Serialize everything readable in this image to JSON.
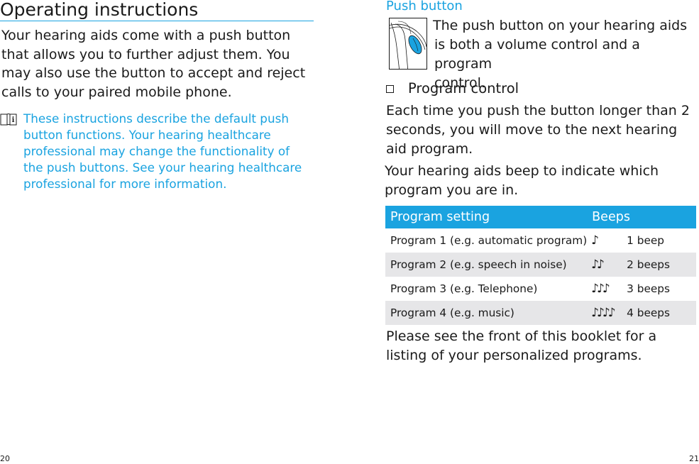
{
  "left_page": {
    "title": "Operating instructions",
    "intro": "Your hearing aids come with a push button that allows you to further adjust them. You may also use the button to accept and reject calls to your paired mobile phone.",
    "note": {
      "icon": "info-book-icon",
      "text": "These instructions describe the default push button functions. Your hearing healthcare professional may change the functionality of the push buttons. See your hearing healthcare professional for more information."
    },
    "page_number": "20"
  },
  "right_page": {
    "section_heading": "Push button",
    "illustration": "hearing-aid-push-button-illustration",
    "device_text": {
      "line1": "The push button on your hearing aids",
      "line2": "is both a volume control and a program",
      "line3": "control."
    },
    "checkbox_label": "Program control",
    "paragraph1": "Each time you push the button longer than 2 seconds, you will move to the next hearing aid program.",
    "paragraph2": "Your hearing aids beep to indicate which program you are in.",
    "table": {
      "headers": {
        "setting": "Program setting",
        "beeps": "Beeps"
      },
      "rows": [
        {
          "setting": "Program 1 (e.g. automatic program)",
          "notes": "♪",
          "beeps": "1 beep"
        },
        {
          "setting": "Program 2 (e.g. speech in noise)",
          "notes": "♪♪",
          "beeps": "2 beeps"
        },
        {
          "setting": "Program 3 (e.g. Telephone)",
          "notes": "♪♪♪",
          "beeps": "3 beeps"
        },
        {
          "setting": "Program 4 (e.g. music)",
          "notes": "♪♪♪♪",
          "beeps": "4 beeps"
        }
      ]
    },
    "closing": "Please see the front of this booklet for a listing of your personalized programs.",
    "page_number": "21"
  },
  "colors": {
    "accent": "#1aa3e0",
    "row_alt": "#e6e6e8",
    "text": "#1a1a1a"
  }
}
